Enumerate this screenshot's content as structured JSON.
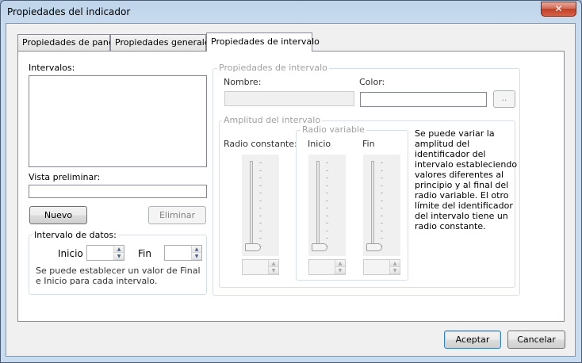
{
  "window": {
    "title": "Propiedades del indicador",
    "close_glyph": "✕"
  },
  "tabs": [
    {
      "label": "Propiedades de panel"
    },
    {
      "label": "Propiedades generales"
    },
    {
      "label": "Propiedades de intervalo"
    }
  ],
  "left": {
    "intervals_label": "Intervalos:",
    "preview_label": "Vista preliminar:",
    "new_button": "Nuevo",
    "delete_button": "Eliminar",
    "data_group": {
      "title": "Intervalo de datos:",
      "start_label": "Inicio",
      "end_label": "Fin",
      "note": "Se puede establecer un valor de Final e Inicio para cada intervalo."
    }
  },
  "right": {
    "group_title": "Propiedades de intervalo",
    "name_label": "Nombre:",
    "color_label": "Color:",
    "color_button": "..",
    "amplitude": {
      "title": "Amplitud del intervalo",
      "constant_label": "Radio constante:",
      "variable_title": "Radio variable",
      "start_label": "Inicio",
      "end_label": "Fin",
      "description_lines": [
        "Se puede variar la",
        "amplitud del",
        "identificador del",
        "intervalo estableciendo",
        "valores diferentes al",
        "principio y al final del",
        "radio variable. El otro",
        "límite del identificador",
        "del intervalo tiene un",
        "radio constante."
      ]
    }
  },
  "footer": {
    "accept": "Aceptar",
    "cancel": "Cancelar"
  }
}
